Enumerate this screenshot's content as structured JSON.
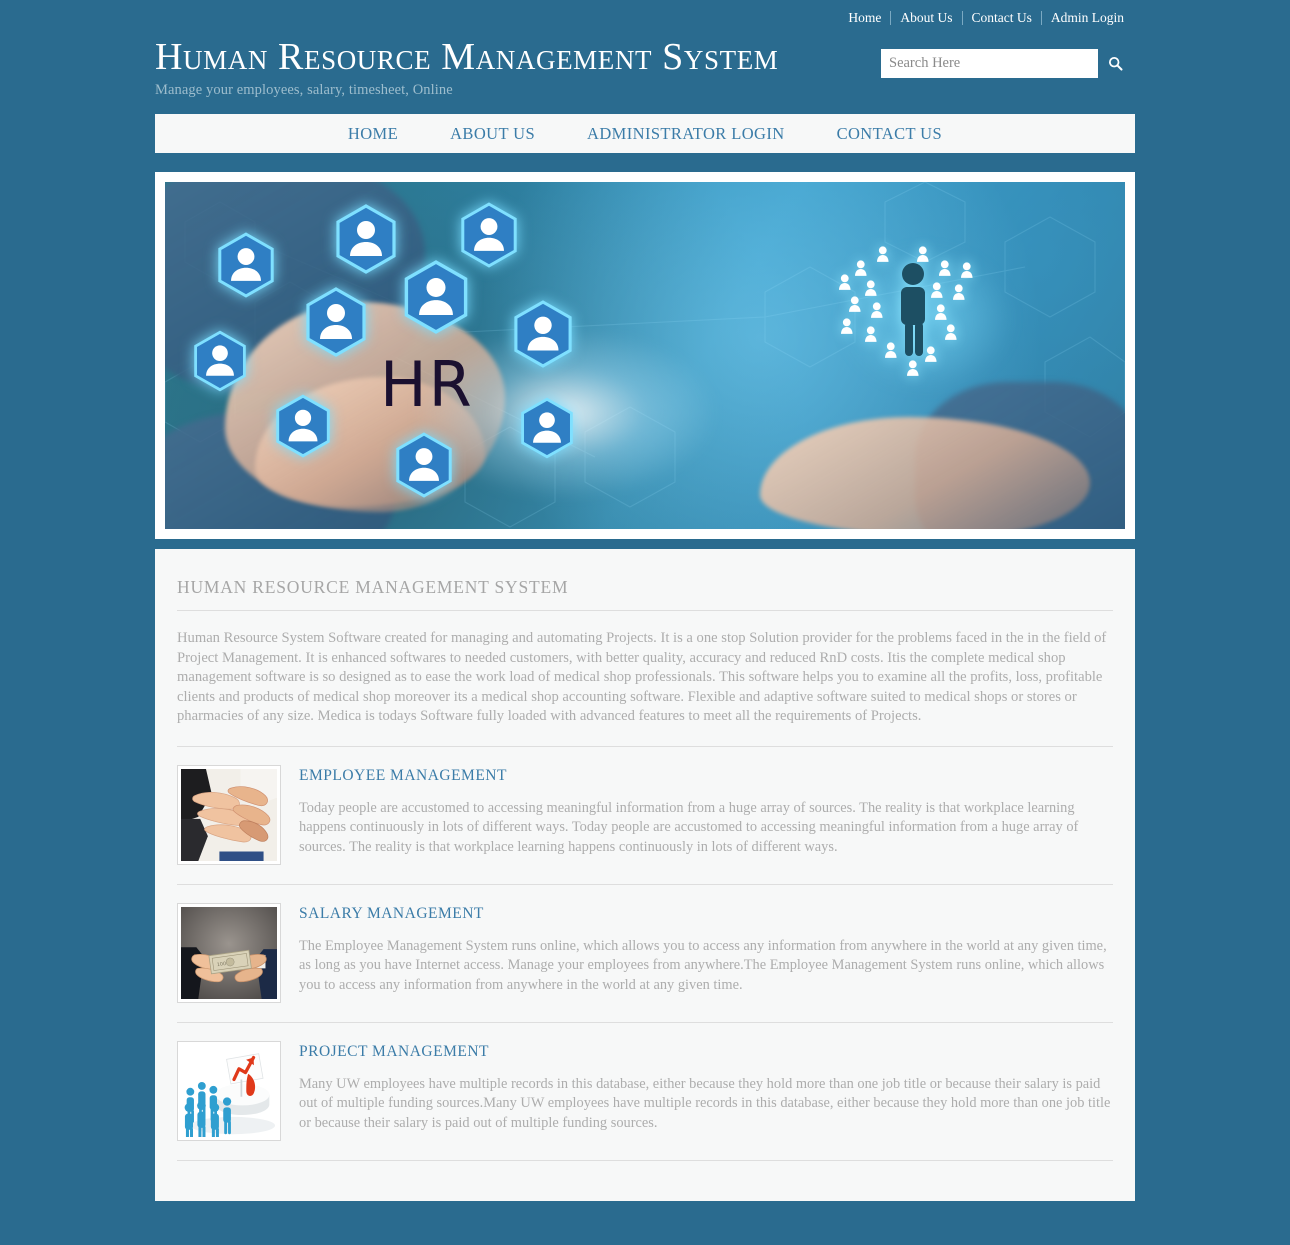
{
  "colors": {
    "page_background": "#2a6b8f",
    "panel_background": "#f7f8f8",
    "link_blue": "#3b7ca8",
    "body_text_gray": "#adadad",
    "heading_gray": "#a6a6a6"
  },
  "topnav": {
    "items": [
      {
        "label": "Home"
      },
      {
        "label": "About Us"
      },
      {
        "label": "Contact Us"
      },
      {
        "label": "Admin Login"
      }
    ]
  },
  "brand": {
    "title": "Human Resource Management System",
    "tagline": "Manage your employees, salary, timesheet, Online"
  },
  "search": {
    "placeholder": "Search Here",
    "value": "",
    "icon": "search-icon"
  },
  "mainnav": {
    "items": [
      {
        "label": "HOME"
      },
      {
        "label": "ABOUT US"
      },
      {
        "label": "ADMINISTRATOR LOGIN"
      },
      {
        "label": "CONTACT US"
      }
    ]
  },
  "hero": {
    "overlay_text": "HR",
    "alt": "Businessman holding glowing HR network of people icons"
  },
  "main": {
    "section_title": "HUMAN RESOURCE MANAGEMENT SYSTEM",
    "intro": "Human Resource System Software created for managing and automating Projects. It is a one stop Solution provider for the problems faced in the in the field of Project Management. It is enhanced softwares to needed customers, with better quality, accuracy and reduced RnD costs. Itis the complete medical shop management software is so designed as to ease the work load of medical shop professionals. This software helps you to examine all the profits, loss, profitable clients and products of medical shop moreover its a medical shop accounting software. Flexible and adaptive software suited to medical shops or stores or pharmacies of any size. Medica is todays Software fully loaded with advanced features to meet all the requirements of Projects.",
    "features": [
      {
        "title": "EMPLOYEE MANAGEMENT",
        "text": "Today people are accustomed to accessing meaningful information from a huge array of sources. The reality is that workplace learning happens continuously in lots of different ways. Today people are accustomed to accessing meaningful information from a huge array of sources. The reality is that workplace learning happens continuously in lots of different ways.",
        "image_alt": "Team stacking hands together"
      },
      {
        "title": "SALARY MANAGEMENT",
        "text": "The Employee Management System runs online, which allows you to access any information from anywhere in the world at any given time, as long as you have Internet access. Manage your employees from anywhere.The Employee Management System runs online, which allows you to access any information from anywhere in the world at any given time.",
        "image_alt": "Hands exchanging cash money"
      },
      {
        "title": "PROJECT MANAGEMENT",
        "text": "Many UW employees have multiple records in this database, either because they hold more than one job title or because their salary is paid out of multiple funding sources.Many UW employees have multiple records in this database, either because they hold more than one job title or because their salary is paid out of multiple funding sources.",
        "image_alt": "Blue 3D figures facing podium with red arrow chart"
      }
    ]
  }
}
